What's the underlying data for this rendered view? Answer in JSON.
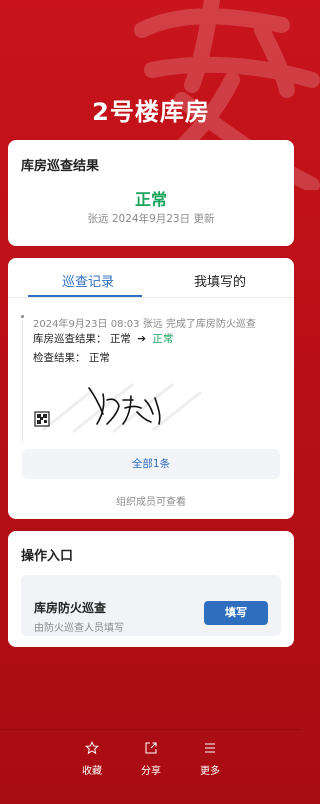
{
  "page": {
    "title": "2号楼库房"
  },
  "result_card": {
    "heading": "库房巡查结果",
    "status": "正常",
    "status_color": "#19a45a",
    "updated": "张远 2024年9月23日 更新"
  },
  "records_card": {
    "tabs": [
      {
        "label": "巡查记录",
        "active": true
      },
      {
        "label": "我填写的",
        "active": false
      }
    ],
    "record": {
      "summary": "2024年9月23日 08:03 张远 完成了库房防火巡查",
      "change_label": "库房巡查结果：",
      "change_from": "正常",
      "change_arrow": "➔",
      "change_to": "正常",
      "check_result": "检查结果： 正常"
    },
    "view_all_button": "全部1条",
    "note": "组织成员可查看"
  },
  "operations_card": {
    "heading": "操作入口",
    "entry_name": "库房防火巡查",
    "entry_desc": "由防火巡查人员填写",
    "fill_button": "填写"
  },
  "bottom_bar": {
    "items": [
      {
        "label": "收藏",
        "icon": "star-icon"
      },
      {
        "label": "分享",
        "icon": "share-icon"
      },
      {
        "label": "更多",
        "icon": "menu-icon"
      }
    ]
  },
  "colors": {
    "brand_red": "#c9141c",
    "accent_blue": "#2f6fbf",
    "success_green": "#19a45a"
  }
}
